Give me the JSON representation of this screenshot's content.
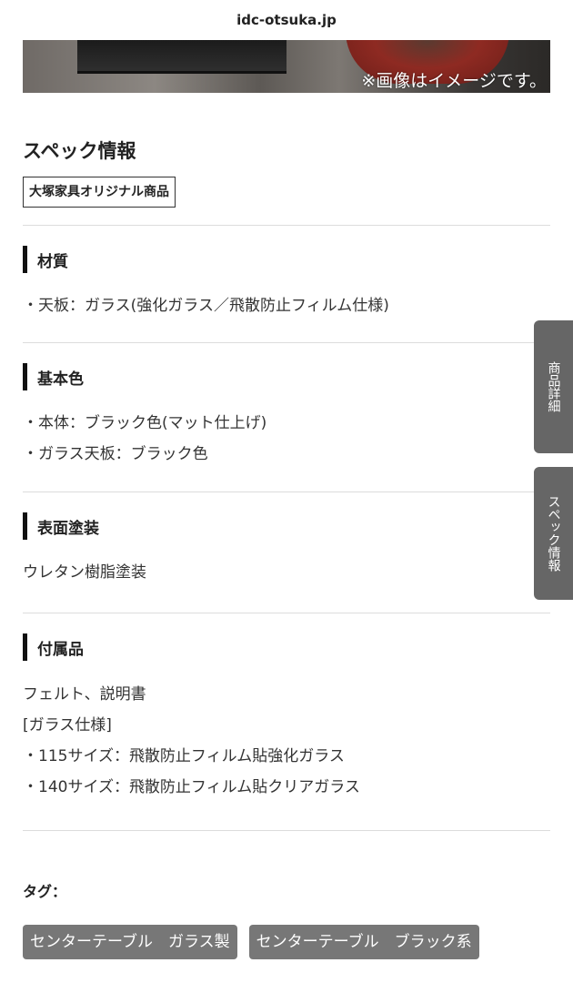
{
  "browser": {
    "url": "idc-otsuka.jp"
  },
  "hero": {
    "note": "※画像はイメージです。"
  },
  "spec": {
    "title": "スペック情報",
    "badge": "大塚家具オリジナル商品",
    "sections": [
      {
        "heading": "材質",
        "lines": [
          "・天板：ガラス(強化ガラス／飛散防止フィルム仕様)"
        ]
      },
      {
        "heading": "基本色",
        "lines": [
          "・本体：ブラック色(マット仕上げ)",
          "・ガラス天板：ブラック色"
        ]
      },
      {
        "heading": "表面塗装",
        "lines": [
          "ウレタン樹脂塗装"
        ]
      },
      {
        "heading": "付属品",
        "lines": [
          "フェルト、説明書",
          "[ガラス仕様]",
          "・115サイズ：飛散防止フィルム貼強化ガラス",
          "・140サイズ：飛散防止フィルム貼クリアガラス"
        ]
      }
    ]
  },
  "tags": {
    "label": "タグ：",
    "items": [
      "センターテーブル　ガラス製",
      "センターテーブル　ブラック系"
    ]
  },
  "side_tabs": [
    "商品詳細",
    "スペック情報"
  ],
  "colors": {
    "tag_bg": "#777777",
    "side_tab_bg": "#666666",
    "heading_bar": "#111111"
  }
}
